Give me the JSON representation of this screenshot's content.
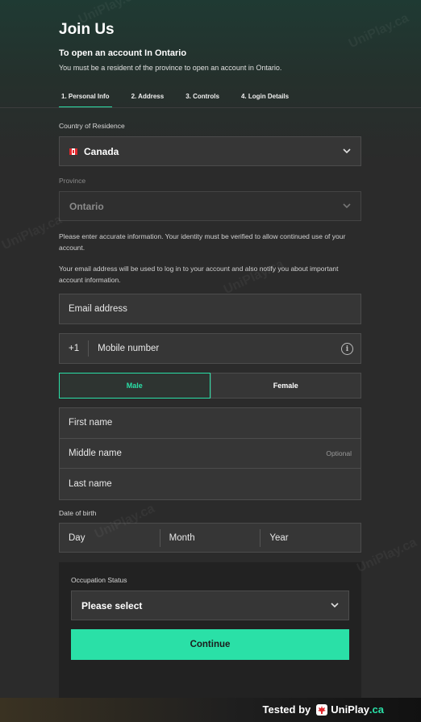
{
  "page": {
    "title": "Join Us",
    "subtitle": "To open an account In Ontario",
    "description": "You must be a resident of the province to open an account in Ontario."
  },
  "steps": [
    {
      "label": "1. Personal Info",
      "active": true
    },
    {
      "label": "2. Address",
      "active": false
    },
    {
      "label": "3. Controls",
      "active": false
    },
    {
      "label": "4. Login Details",
      "active": false
    }
  ],
  "country": {
    "label": "Country of Residence",
    "value": "Canada",
    "flag_icon": "canada-flag-icon"
  },
  "province": {
    "label": "Province",
    "value": "Ontario",
    "disabled": true
  },
  "notices": {
    "accuracy": "Please enter accurate information. Your identity must be verified to allow continued use of your account.",
    "email": "Your email address will be used to log in to your account and also notify you about important account information."
  },
  "email": {
    "placeholder": "Email address"
  },
  "mobile": {
    "prefix": "+1",
    "placeholder": "Mobile number"
  },
  "gender": {
    "male": "Male",
    "female": "Female",
    "selected": "Male"
  },
  "names": {
    "first": "First name",
    "middle": "Middle name",
    "middle_hint": "Optional",
    "last": "Last name"
  },
  "dob": {
    "label": "Date of birth",
    "day": "Day",
    "month": "Month",
    "year": "Year"
  },
  "occupation": {
    "label": "Occupation Status",
    "value": "Please select"
  },
  "actions": {
    "continue": "Continue"
  },
  "footer": {
    "tested_by": "Tested by",
    "brand_main": "UniPlay",
    "brand_suffix": ".ca"
  },
  "watermark": "UniPlay.ca",
  "colors": {
    "accent": "#2ae0a7",
    "background": "#2b2b2b",
    "field": "#363636",
    "maple_red": "#e0262b"
  }
}
